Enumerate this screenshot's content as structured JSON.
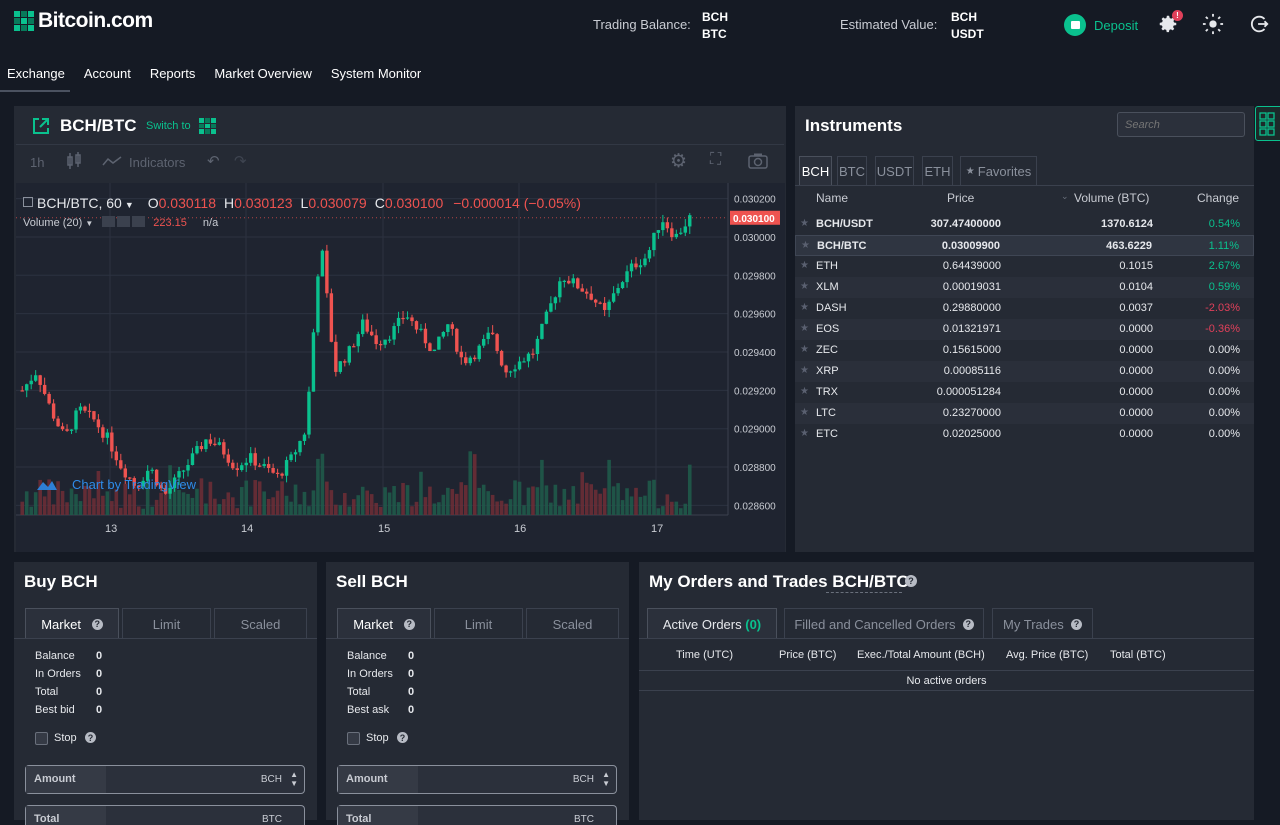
{
  "header": {
    "logo": "Bitcoin.com",
    "trading_balance_label": "Trading Balance:",
    "trading_balance_currencies": [
      "BCH",
      "BTC"
    ],
    "estimated_value_label": "Estimated Value:",
    "estimated_value_currencies": [
      "BCH",
      "USDT"
    ],
    "deposit_label": "Deposit",
    "notification_badge": "!"
  },
  "nav": {
    "items": [
      "Exchange",
      "Account",
      "Reports",
      "Market Overview",
      "System Monitor"
    ],
    "active": "Exchange"
  },
  "chart_panel": {
    "pair": "BCH/BTC",
    "switch_label": "Switch to",
    "toolbar": {
      "interval": "1h",
      "indicators": "Indicators"
    },
    "legend": {
      "symbol": "BCH/BTC, 60",
      "o_label": "O",
      "o": "0.030118",
      "h_label": "H",
      "h": "0.030123",
      "l_label": "L",
      "l": "0.030079",
      "c_label": "C",
      "c": "0.030100",
      "change": "−0.000014 (−0.05%)",
      "volume_label": "Volume (20)",
      "volume_value": "223.15",
      "volume_na": "n/a"
    },
    "watermark": "Chart by TradingView",
    "colors": {
      "up": "#26a69a",
      "down": "#ef5350",
      "up_accent": "#0ac18e"
    }
  },
  "chart_data": {
    "type": "candlestick",
    "symbol": "BCH/BTC",
    "interval": "60",
    "x_ticks": [
      "13",
      "14",
      "15",
      "16",
      "17"
    ],
    "y_ticks": [
      "0.030200",
      "0.030000",
      "0.029800",
      "0.029600",
      "0.029400",
      "0.029200",
      "0.029000",
      "0.028800",
      "0.028600"
    ],
    "ylim": [
      0.02855,
      0.03025
    ],
    "last_price": "0.030100",
    "ohlc_path": [
      0.0292,
      0.0293,
      0.0291,
      0.02895,
      0.0291,
      0.02905,
      0.02895,
      0.0288,
      0.0287,
      0.0288,
      0.02865,
      0.02875,
      0.02885,
      0.02895,
      0.0289,
      0.0288,
      0.02885,
      0.0288,
      0.02875,
      0.02885,
      0.029,
      0.03,
      0.0293,
      0.0294,
      0.02955,
      0.02945,
      0.0295,
      0.0296,
      0.0295,
      0.0294,
      0.02955,
      0.02935,
      0.0294,
      0.0295,
      0.0293,
      0.02935,
      0.0294,
      0.0296,
      0.0298,
      0.02975,
      0.0297,
      0.0296,
      0.02975,
      0.02985,
      0.0299,
      0.0301,
      0.03,
      0.0301
    ]
  },
  "instruments": {
    "title": "Instruments",
    "search_placeholder": "Search",
    "tabs": [
      "BCH",
      "BTC",
      "USDT",
      "ETH",
      "Favorites"
    ],
    "columns": [
      "Name",
      "Price",
      "Volume (BTC)",
      "Change"
    ],
    "rows": [
      {
        "name": "BCH/USDT",
        "price": "307.47400000",
        "volume": "1370.6124",
        "change": "0.54%",
        "dir": "pos"
      },
      {
        "name": "BCH/BTC",
        "price": "0.03009900",
        "volume": "463.6229",
        "change": "1.11%",
        "dir": "pos"
      },
      {
        "name": "ETH",
        "price": "0.64439000",
        "volume": "0.1015",
        "change": "2.67%",
        "dir": "pos"
      },
      {
        "name": "XLM",
        "price": "0.00019031",
        "volume": "0.0104",
        "change": "0.59%",
        "dir": "pos"
      },
      {
        "name": "DASH",
        "price": "0.29880000",
        "volume": "0.0037",
        "change": "-2.03%",
        "dir": "neg"
      },
      {
        "name": "EOS",
        "price": "0.01321971",
        "volume": "0.0000",
        "change": "-0.36%",
        "dir": "neg"
      },
      {
        "name": "ZEC",
        "price": "0.15615000",
        "volume": "0.0000",
        "change": "0.00%",
        "dir": "zero"
      },
      {
        "name": "XRP",
        "price": "0.00085116",
        "volume": "0.0000",
        "change": "0.00%",
        "dir": "zero"
      },
      {
        "name": "TRX",
        "price": "0.000051284",
        "volume": "0.0000",
        "change": "0.00%",
        "dir": "zero"
      },
      {
        "name": "LTC",
        "price": "0.23270000",
        "volume": "0.0000",
        "change": "0.00%",
        "dir": "zero"
      },
      {
        "name": "ETC",
        "price": "0.02025000",
        "volume": "0.0000",
        "change": "0.00%",
        "dir": "zero"
      }
    ]
  },
  "buy": {
    "title": "Buy BCH",
    "tabs": [
      "Market",
      "Limit",
      "Scaled"
    ],
    "balance_label": "Balance",
    "balance": "0",
    "in_orders_label": "In Orders",
    "in_orders": "0",
    "total_label": "Total",
    "total": "0",
    "best_label": "Best bid",
    "best": "0",
    "stop_label": "Stop",
    "amount_label": "Amount",
    "amount_unit": "BCH",
    "total_field_label": "Total",
    "total_unit": "BTC"
  },
  "sell": {
    "title": "Sell BCH",
    "tabs": [
      "Market",
      "Limit",
      "Scaled"
    ],
    "balance_label": "Balance",
    "balance": "0",
    "in_orders_label": "In Orders",
    "in_orders": "0",
    "total_label": "Total",
    "total": "0",
    "best_label": "Best ask",
    "best": "0",
    "stop_label": "Stop",
    "amount_label": "Amount",
    "amount_unit": "BCH",
    "total_field_label": "Total",
    "total_unit": "BTC"
  },
  "orders": {
    "title": "My Orders and Trades BCH/BTC",
    "tab_active": "Active Orders",
    "tab_active_count": "(0)",
    "tab_filled": "Filled and Cancelled Orders",
    "tab_trades": "My Trades",
    "columns": [
      "Time (UTC)",
      "Price (BTC)",
      "Exec./Total Amount (BCH)",
      "Avg. Price (BTC)",
      "Total (BTC)"
    ],
    "empty": "No active orders"
  }
}
